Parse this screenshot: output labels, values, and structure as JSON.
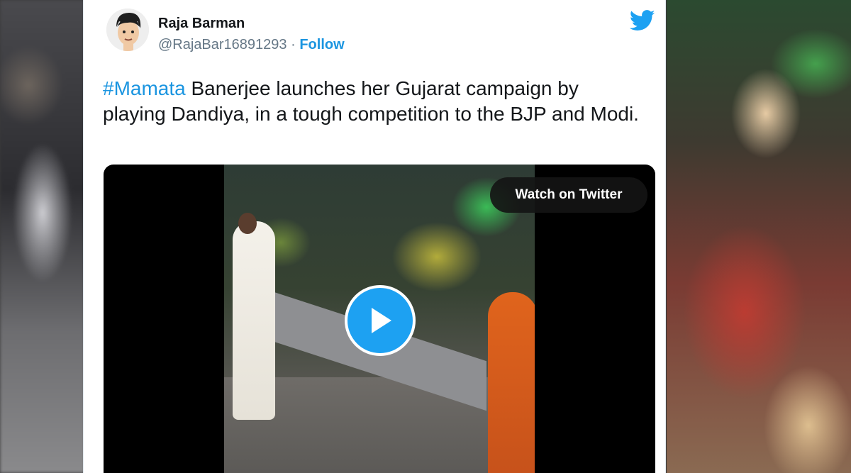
{
  "tweet": {
    "author_name": "Raja Barman",
    "handle": "@RajaBar16891293",
    "separator": "·",
    "follow_label": "Follow",
    "hashtag": "#Mamata",
    "text_rest": " Banerjee launches her Gujarat campaign by playing Dandiya, in a tough competition to the BJP and Modi."
  },
  "video": {
    "watch_label": "Watch on Twitter",
    "play_icon": "play-icon"
  },
  "icons": {
    "brand": "twitter-bird-icon",
    "avatar": "avatar-illustration"
  },
  "colors": {
    "link_blue": "#1b95e0",
    "twitter_blue": "#1da1f2",
    "text_primary": "#14171a",
    "text_secondary": "#657786"
  }
}
